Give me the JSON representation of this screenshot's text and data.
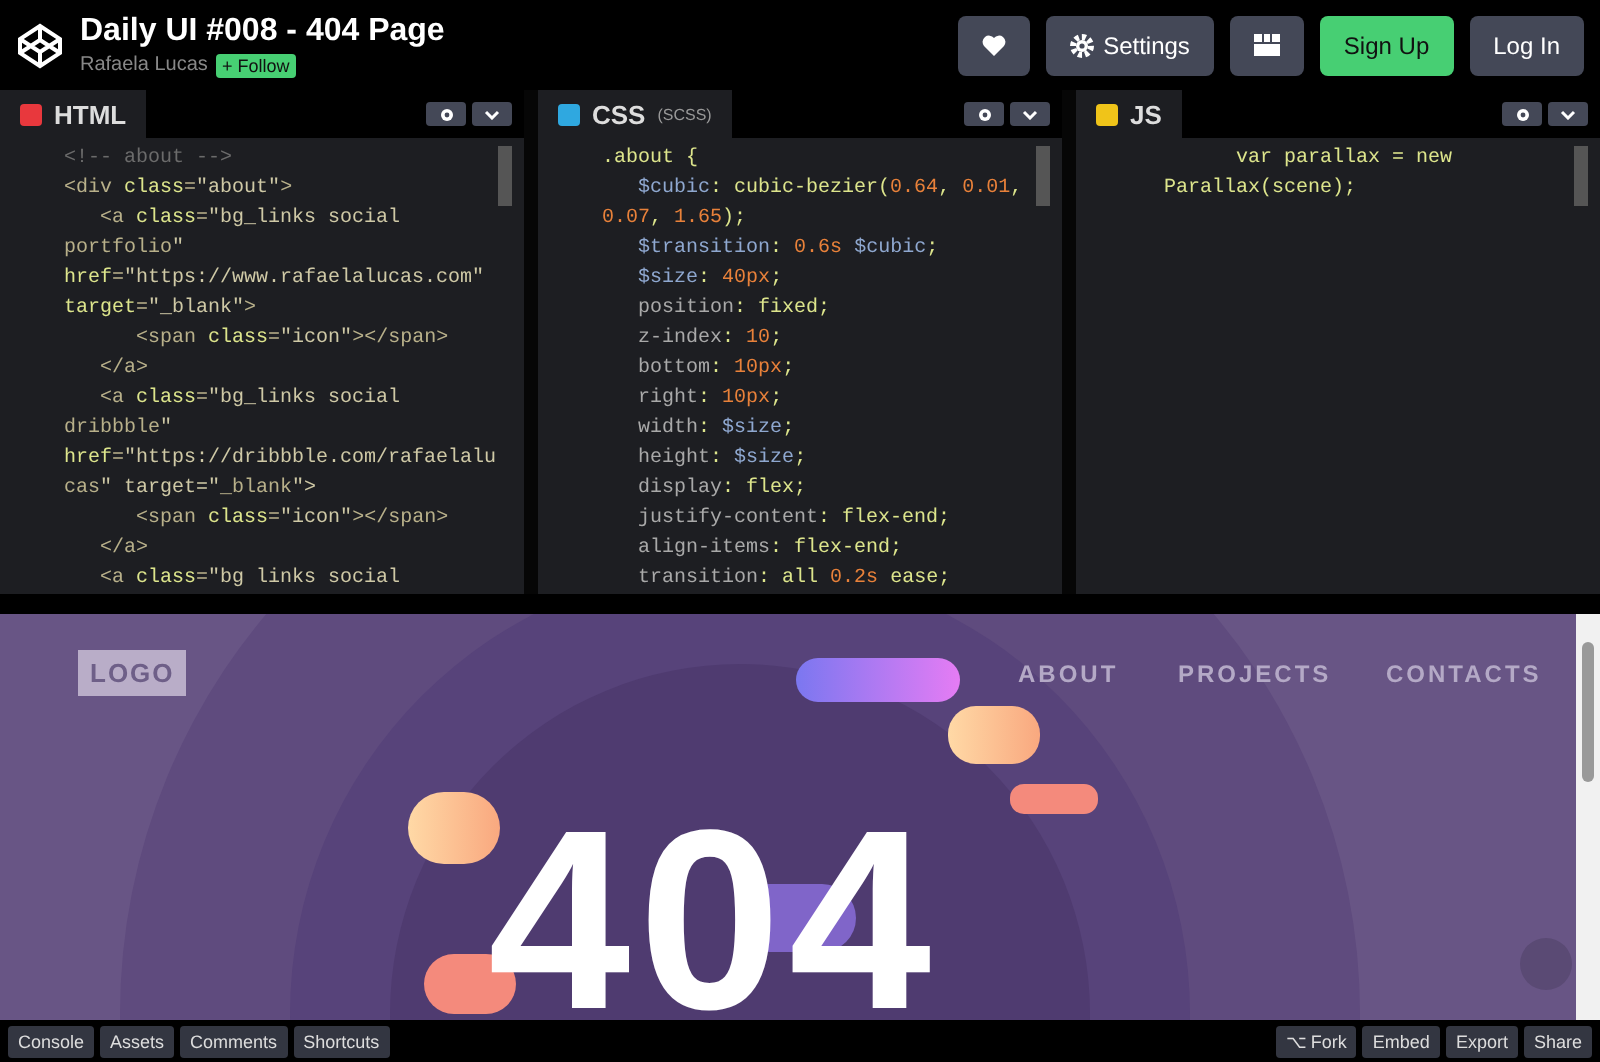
{
  "header": {
    "title": "Daily UI #008 - 404 Page",
    "author": "Rafaela Lucas",
    "follow": "+ Follow",
    "buttons": [
      {
        "kind": "heart"
      },
      {
        "kind": "settings",
        "label": "Settings"
      },
      {
        "kind": "layout"
      },
      {
        "kind": "signup",
        "label": "Sign Up"
      },
      {
        "kind": "login",
        "label": "Log In"
      }
    ]
  },
  "editors": [
    {
      "kind": "html",
      "label": "HTML",
      "lines": [
        "<!-- about -->",
        "<div class=\"about\">",
        "   <a class=\"bg_links social",
        "portfolio\"",
        "href=\"https://www.rafaelalucas.com\"",
        "target=\"_blank\">",
        "      <span class=\"icon\"></span>",
        "   </a>",
        "   <a class=\"bg_links social",
        "dribbble\"",
        "href=\"https://dribbble.com/rafaelalu",
        "cas\" target=\"_blank\">",
        "      <span class=\"icon\"></span>",
        "   </a>",
        "   <a class=\"bg links social"
      ]
    },
    {
      "kind": "css",
      "label": "CSS",
      "sublabel": "(SCSS)",
      "lines": [
        ".about {",
        "   $cubic: cubic-bezier(0.64, 0.01,",
        "0.07, 1.65);",
        "   $transition: 0.6s $cubic;",
        "   $size: 40px;",
        "   position: fixed;",
        "   z-index: 10;",
        "   bottom: 10px;",
        "   right: 10px;",
        "   width: $size;",
        "   height: $size;",
        "   display: flex;",
        "   justify-content: flex-end;",
        "   align-items: flex-end;",
        "   transition: all 0.2s ease;"
      ]
    },
    {
      "kind": "js",
      "label": "JS",
      "lines": [
        "        var parallax = new",
        "  Parallax(scene);"
      ]
    }
  ],
  "preview": {
    "logo": "LOGO",
    "nav": [
      "ABOUT",
      "PROJECTS",
      "CONTACTS"
    ],
    "headline": "404"
  },
  "footer": {
    "left": [
      "Console",
      "Assets",
      "Comments",
      "Shortcuts"
    ],
    "right": [
      "⌥ Fork",
      "Embed",
      "Export",
      "Share"
    ]
  }
}
